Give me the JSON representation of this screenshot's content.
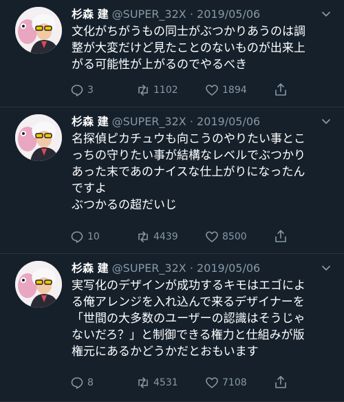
{
  "tweets": [
    {
      "name": "杉森 建",
      "handle": "@SUPER_32X",
      "separator": "·",
      "date": "2019/05/06",
      "lines": [
        "文化がちがうもの同士がぶつかりあうのは調",
        "整が大変だけど見たことのないものが出来上",
        "がる可能性が上がるのでやるべき"
      ],
      "replies": "3",
      "retweets": "1102",
      "likes": "1894"
    },
    {
      "name": "杉森 建",
      "handle": "@SUPER_32X",
      "separator": "·",
      "date": "2019/05/06",
      "lines": [
        "名探偵ピカチュウも向こうのやりたい事とこ",
        "っちの守りたい事が結構なレベルでぶつかり",
        "あった末であのナイスな仕上がりになったん",
        "ですよ",
        "ぶつかるの超だいじ"
      ],
      "replies": "10",
      "retweets": "4439",
      "likes": "8500"
    },
    {
      "name": "杉森 建",
      "handle": "@SUPER_32X",
      "separator": "·",
      "date": "2019/05/06",
      "lines": [
        "実写化のデザインが成功するキモはエゴによ",
        "る俺アレンジを入れ込んで来るデザイナーを",
        "「世間の大多数のユーザーの認識はそうじゃ",
        "ないだろ？」と制御できる権力と仕組みが版",
        "権元にあるかどうかだとおもいます"
      ],
      "replies": "8",
      "retweets": "4531",
      "likes": "7108"
    }
  ],
  "icons": {
    "reply": "reply-icon",
    "retweet": "retweet-icon",
    "like": "heart-icon",
    "share": "share-icon",
    "more": "chevron-down-icon"
  },
  "colors": {
    "background": "#15202b",
    "muted": "#8899a6",
    "divider": "#2f3336"
  }
}
